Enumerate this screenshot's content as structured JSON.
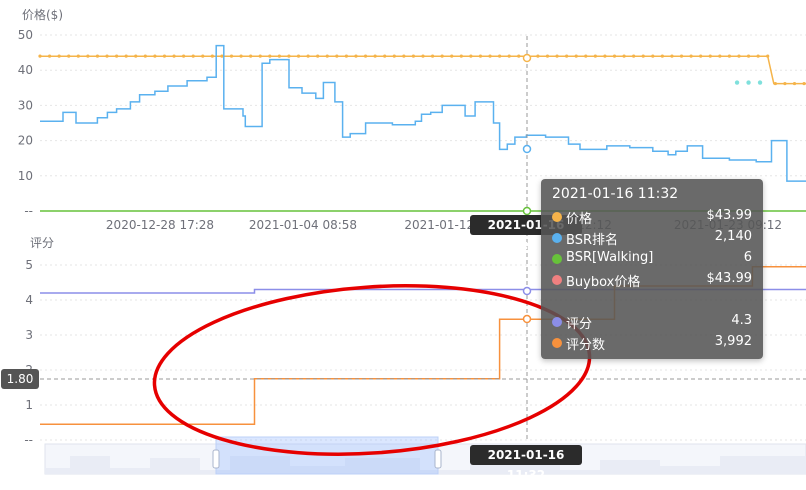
{
  "chart_data": [
    {
      "type": "line",
      "ylabel": "价格($)",
      "ylim": [
        0,
        50
      ],
      "yticks": [
        "--",
        "10",
        "20",
        "30",
        "40",
        "50"
      ],
      "xticks": [
        "2020-12-28 17:28",
        "2021-01-04 08:58",
        "2021-01-12 0",
        "18 22:12",
        "2021-01-23 09:12"
      ],
      "series": [
        {
          "name": "价格",
          "color": "#f5b44a",
          "values": [
            [
              0,
              43.99
            ],
            [
              0.22,
              43.99
            ],
            [
              0.5,
              43.99
            ],
            [
              0.75,
              43.99
            ],
            [
              0.95,
              43.99
            ],
            [
              0.958,
              36.2
            ],
            [
              1,
              36.2
            ]
          ]
        },
        {
          "name": "BSR排名",
          "color": "#5ab1ef",
          "values": [
            [
              0,
              25.5
            ],
            [
              0.03,
              25.5
            ],
            [
              0.03,
              28
            ],
            [
              0.047,
              28
            ],
            [
              0.047,
              25
            ],
            [
              0.075,
              25
            ],
            [
              0.075,
              26.5
            ],
            [
              0.088,
              26.5
            ],
            [
              0.088,
              28
            ],
            [
              0.1,
              28
            ],
            [
              0.1,
              29
            ],
            [
              0.118,
              29
            ],
            [
              0.118,
              31
            ],
            [
              0.13,
              31
            ],
            [
              0.13,
              33
            ],
            [
              0.15,
              33
            ],
            [
              0.15,
              34
            ],
            [
              0.167,
              34
            ],
            [
              0.167,
              35.5
            ],
            [
              0.192,
              35.5
            ],
            [
              0.192,
              37
            ],
            [
              0.218,
              37
            ],
            [
              0.218,
              38
            ],
            [
              0.23,
              38
            ],
            [
              0.23,
              47
            ],
            [
              0.24,
              47
            ],
            [
              0.24,
              47
            ],
            [
              0.24,
              29
            ],
            [
              0.265,
              29
            ],
            [
              0.265,
              27
            ],
            [
              0.268,
              27
            ],
            [
              0.268,
              24
            ],
            [
              0.29,
              24
            ],
            [
              0.29,
              42
            ],
            [
              0.3,
              42
            ],
            [
              0.3,
              43
            ],
            [
              0.325,
              43
            ],
            [
              0.325,
              35
            ],
            [
              0.342,
              35
            ],
            [
              0.342,
              33.5
            ],
            [
              0.36,
              33.5
            ],
            [
              0.36,
              32
            ],
            [
              0.37,
              32
            ],
            [
              0.37,
              36.5
            ],
            [
              0.385,
              36.5
            ],
            [
              0.385,
              31
            ],
            [
              0.395,
              31
            ],
            [
              0.395,
              21
            ],
            [
              0.405,
              21
            ],
            [
              0.405,
              22
            ],
            [
              0.425,
              22
            ],
            [
              0.425,
              25
            ],
            [
              0.46,
              25
            ],
            [
              0.46,
              24.5
            ],
            [
              0.49,
              24.5
            ],
            [
              0.49,
              25.5
            ],
            [
              0.498,
              25.5
            ],
            [
              0.498,
              27.5
            ],
            [
              0.51,
              27.5
            ],
            [
              0.51,
              28
            ],
            [
              0.525,
              28
            ],
            [
              0.525,
              30
            ],
            [
              0.555,
              30
            ],
            [
              0.555,
              27
            ],
            [
              0.568,
              27
            ],
            [
              0.568,
              31
            ],
            [
              0.592,
              31
            ],
            [
              0.592,
              25
            ],
            [
              0.6,
              25
            ],
            [
              0.6,
              17.5
            ],
            [
              0.61,
              17.5
            ],
            [
              0.61,
              19
            ],
            [
              0.62,
              19
            ],
            [
              0.62,
              21
            ],
            [
              0.635,
              21
            ],
            [
              0.635,
              21.5
            ],
            [
              0.66,
              21.5
            ],
            [
              0.66,
              21
            ],
            [
              0.69,
              21
            ],
            [
              0.69,
              19
            ],
            [
              0.705,
              19
            ],
            [
              0.705,
              17.5
            ],
            [
              0.74,
              17.5
            ],
            [
              0.74,
              18.5
            ],
            [
              0.77,
              18.5
            ],
            [
              0.77,
              18
            ],
            [
              0.8,
              18
            ],
            [
              0.8,
              17
            ],
            [
              0.82,
              17
            ],
            [
              0.82,
              16
            ],
            [
              0.83,
              16
            ],
            [
              0.83,
              17
            ],
            [
              0.845,
              17
            ],
            [
              0.845,
              18.5
            ],
            [
              0.855,
              18.5
            ],
            [
              0.855,
              18.5
            ],
            [
              0.865,
              18.5
            ],
            [
              0.865,
              15
            ],
            [
              0.9,
              15
            ],
            [
              0.9,
              14.5
            ],
            [
              0.935,
              14.5
            ],
            [
              0.935,
              14
            ],
            [
              0.955,
              14
            ],
            [
              0.955,
              20
            ],
            [
              0.975,
              20
            ],
            [
              0.975,
              8.5
            ],
            [
              1,
              8.5
            ]
          ]
        },
        {
          "name": "BSR[Walking]",
          "color": "#67c23a",
          "values": [
            [
              0,
              0
            ],
            [
              1,
              0
            ]
          ]
        },
        {
          "name": "Buybox价格",
          "color": "#7fe0dc",
          "values": [
            [
              0.91,
              36.5
            ],
            [
              0.925,
              36.5
            ],
            [
              0.94,
              36.5
            ]
          ]
        }
      ]
    },
    {
      "type": "line",
      "ylabel": "评分",
      "ylim": [
        0,
        5
      ],
      "yticks": [
        "--",
        "1",
        "2",
        "3",
        "4",
        "5"
      ],
      "series": [
        {
          "name": "评分",
          "color": "#8c8ee8",
          "values": [
            [
              0,
              4.2
            ],
            [
              0.28,
              4.2
            ],
            [
              0.28,
              4.3
            ],
            [
              1,
              4.3
            ]
          ]
        },
        {
          "name": "评分数",
          "color": "#f7913d",
          "values": [
            [
              0,
              0.45
            ],
            [
              0.28,
              0.45
            ],
            [
              0.28,
              1.75
            ],
            [
              0.6,
              1.75
            ],
            [
              0.6,
              3.45
            ],
            [
              0.66,
              3.45
            ],
            [
              0.66,
              3.45
            ],
            [
              0.75,
              3.45
            ],
            [
              0.75,
              4.4
            ],
            [
              0.82,
              4.4
            ],
            [
              0.82,
              4.4
            ],
            [
              0.93,
              4.4
            ],
            [
              0.93,
              4.95
            ],
            [
              1,
              4.95
            ]
          ]
        }
      ]
    }
  ],
  "tooltip": {
    "title": "2021-01-16 11:32",
    "rows": [
      {
        "name": "价格",
        "value": "$43.99",
        "color": "#f5b44a"
      },
      {
        "name": "BSR排名",
        "value": "2,140",
        "color": "#5ab1ef"
      },
      {
        "name": "BSR[Walking]",
        "value": "6",
        "color": "#67c23a"
      },
      {
        "name": "Buybox价格",
        "value": "$43.99",
        "color": "#f08080"
      },
      {
        "name": "评分",
        "value": "4.3",
        "color": "#8c8ee8"
      },
      {
        "name": "评分数",
        "value": "3,992",
        "color": "#f7913d"
      }
    ]
  },
  "cursor": {
    "time_label": "2021-01-16 11:32",
    "y_value_label": "1.80"
  },
  "annotation_color": "#e60000"
}
